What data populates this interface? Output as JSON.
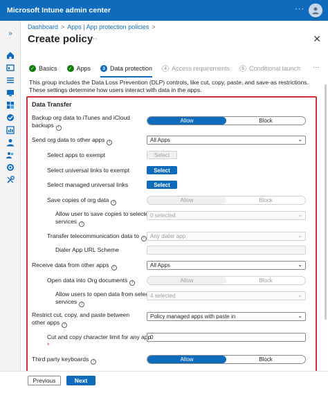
{
  "app": {
    "title": "Microsoft Intune admin center",
    "more": "···"
  },
  "nav": {
    "expand": "»"
  },
  "breadcrumb": {
    "items": [
      "Dashboard",
      "Apps | App protection policies"
    ],
    "sep": ">"
  },
  "page": {
    "title": "Create policy",
    "more": "···",
    "close": "✕"
  },
  "tabs": {
    "items": [
      {
        "label": "Basics",
        "step": "✓"
      },
      {
        "label": "Apps",
        "step": "✓"
      },
      {
        "label": "Data protection",
        "step": "3"
      },
      {
        "label": "Access requirements",
        "step": "4"
      },
      {
        "label": "Conditional launch",
        "step": "5"
      }
    ],
    "more": "···"
  },
  "description": "This group includes the Data Loss Prevention (DLP) controls, like cut, copy, paste, and save-as restrictions. These settings determine how users interact with data in the apps.",
  "section": {
    "title": "Data Transfer",
    "backup": {
      "label_line1": "Backup org data to iTunes and iCloud",
      "label_line2": "backups",
      "on": "Allow",
      "off": "Block"
    },
    "send": {
      "label": "Send org data to other apps",
      "value": "All Apps"
    },
    "exempt": {
      "label": "Select apps to exempt",
      "button": "Select"
    },
    "universal": {
      "label": "Select universal links to exempt",
      "button": "Select"
    },
    "managed_universal": {
      "label": "Select managed universal links",
      "button": "Select"
    },
    "save_copies": {
      "label": "Save copies of org data",
      "on": "Allow",
      "off": "Block"
    },
    "allow_save": {
      "label_line1": "Allow user to save copies to selected",
      "label_line2": "services",
      "value": "0 selected"
    },
    "telecom": {
      "label": "Transfer telecommunication data to",
      "value": "Any dialer app"
    },
    "dialer": {
      "label": "Dialer App URL Scheme",
      "value": ""
    },
    "receive": {
      "label": "Receive data from other apps",
      "value": "All Apps"
    },
    "open_into": {
      "label": "Open data into Org documents",
      "on": "Allow",
      "off": "Block"
    },
    "allow_open": {
      "label_line1": "Allow users to open data from selected",
      "label_line2": "services",
      "value": "4 selected"
    },
    "restrict": {
      "label_line1": "Restrict cut, copy, and paste between",
      "label_line2": "other apps",
      "value": "Policy managed apps with paste in"
    },
    "char_limit": {
      "label": "Cut and copy character limit for any app",
      "required": "*",
      "value": "0"
    },
    "keyboards": {
      "label": "Third party keyboards",
      "on": "Allow",
      "off": "Block"
    }
  },
  "footer": {
    "previous": "Previous",
    "next": "Next"
  },
  "colors": {
    "accent": "#0f6cbd",
    "success": "#107c10",
    "highlight": "#d13438"
  }
}
